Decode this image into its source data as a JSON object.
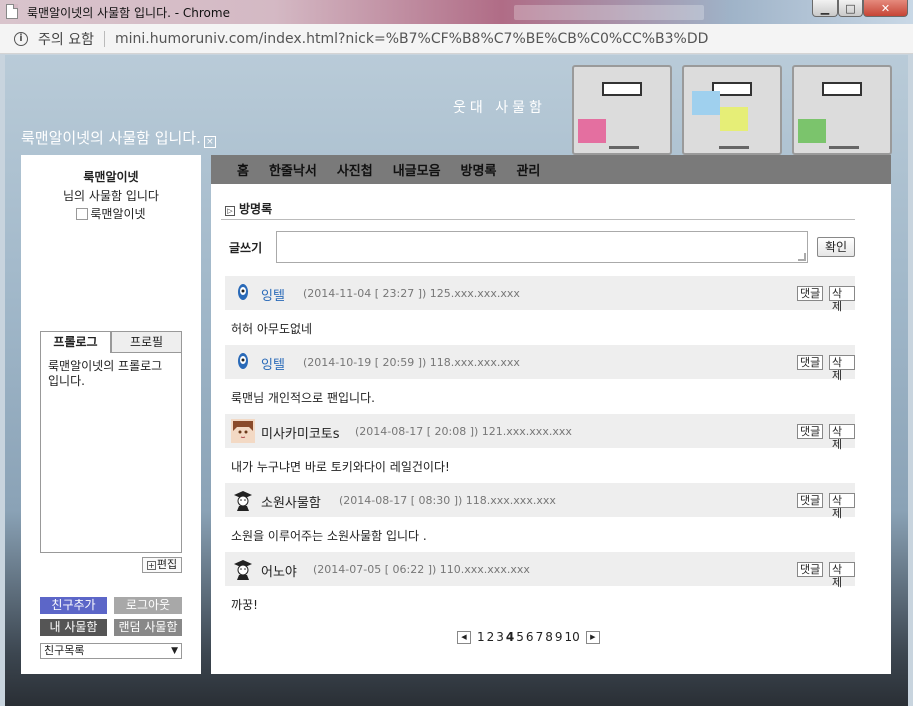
{
  "window": {
    "title": "룩맨알이넷의 사물함 입니다. - Chrome",
    "minimize_icon": "minimize-icon",
    "maximize_icon": "maximize-icon",
    "close_icon": "close-icon"
  },
  "address": {
    "security_label": "주의 요함",
    "url": "mini.humoruniv.com/index.html?nick=%B7%CF%B8%C7%BE%CB%C0%CC%B3%DD"
  },
  "banner": {
    "brand": "웃대 사물함",
    "site_title": "룩맨알이넷의 사물함 입니다."
  },
  "sidebar": {
    "owner_name": "룩맨알이넷",
    "owner_sub": "님의 사물함 입니다",
    "owner_image_alt": "룩맨알이넷",
    "tabs": [
      {
        "label": "프롤로그",
        "active": true
      },
      {
        "label": "프로필",
        "active": false
      }
    ],
    "prologue_text": "룩맨알이넷의 프롤로그 입니다.",
    "edit_label": "편집",
    "buttons": {
      "add_friend": "친구추가",
      "logout": "로그아웃",
      "my_locker": "내 사물함",
      "random_locker": "랜덤 사물함"
    },
    "friend_select": "친구목록"
  },
  "main": {
    "nav": [
      "홈",
      "한줄낙서",
      "사진첩",
      "내글모음",
      "방명록",
      "관리"
    ],
    "section_title": "방명록",
    "write_label": "글쓰기",
    "ok_label": "확인",
    "reply_label": "댓글",
    "delete_label": "삭제",
    "entries": [
      {
        "nick": "잉텔",
        "meta": "(2014-11-04 [ 23:27 ]) 125.xxx.xxx.xxx",
        "body": "허허 아무도없네",
        "avatar": "blue-ghost-icon"
      },
      {
        "nick": "잉텔",
        "meta": "(2014-10-19 [ 20:59 ]) 118.xxx.xxx.xxx",
        "body": "룩맨님 개인적으로 팬입니다.",
        "avatar": "blue-ghost-icon"
      },
      {
        "nick": "미사카미코토s",
        "meta": "(2014-08-17 [ 20:08 ]) 121.xxx.xxx.xxx",
        "body": "내가 누구냐면 바로 토키와다이 레일건이다!",
        "avatar": "anime-girl-avatar"
      },
      {
        "nick": "소원사물함",
        "meta": "(2014-08-17 [ 08:30 ]) 118.xxx.xxx.xxx",
        "body": "소원을 이루어주는 소원사물함 입니다 .",
        "avatar": "graduate-avatar"
      },
      {
        "nick": "어노야",
        "meta": "(2014-07-05 [ 06:22 ]) 110.xxx.xxx.xxx",
        "body": "까꿍!",
        "avatar": "graduate-avatar"
      }
    ],
    "pager": {
      "pages": [
        "1",
        "2",
        "3",
        "4",
        "5",
        "6",
        "7",
        "8",
        "9",
        "10"
      ],
      "current": "4"
    }
  }
}
